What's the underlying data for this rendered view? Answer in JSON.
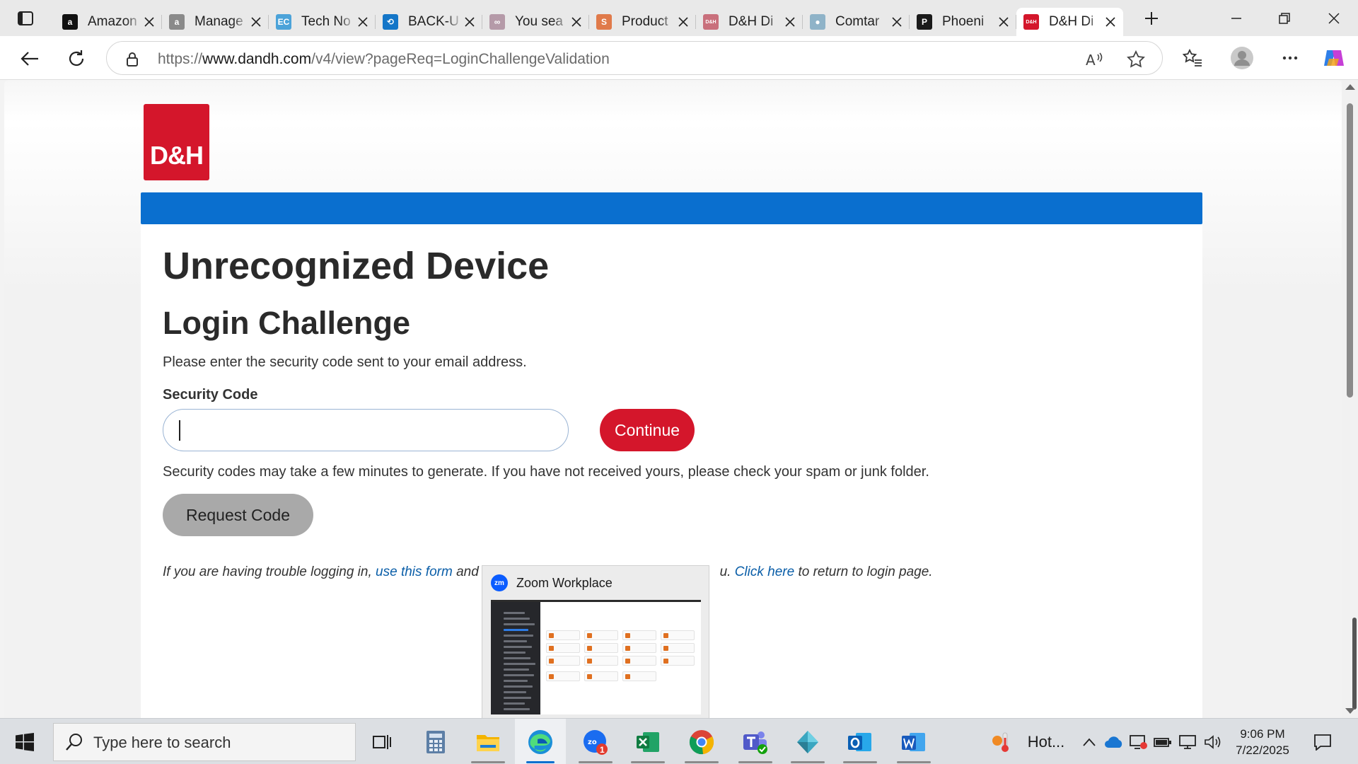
{
  "browser": {
    "tabs": [
      {
        "title": "Amazon",
        "favicon": "amazon-icon",
        "fav_color": "#111111",
        "fav_text": "a"
      },
      {
        "title": "Manage",
        "favicon": "amazon-grey-icon",
        "fav_color": "#8a8a8a",
        "fav_text": "a"
      },
      {
        "title": "Tech No",
        "favicon": "ec-icon",
        "fav_color": "#4ba3d9",
        "fav_text": "EC"
      },
      {
        "title": "BACK-U",
        "favicon": "backup-icon",
        "fav_color": "#1476c8",
        "fav_text": "⟲"
      },
      {
        "title": "You sea",
        "favicon": "people-icon",
        "fav_color": "#b59aa8",
        "fav_text": "∞"
      },
      {
        "title": "Product",
        "favicon": "product-icon",
        "fav_color": "#e07a4a",
        "fav_text": "S"
      },
      {
        "title": "D&H Di",
        "favicon": "dh-faded-icon",
        "fav_color": "#c9707c",
        "fav_text": "D&H"
      },
      {
        "title": "Comtar",
        "favicon": "comtar-icon",
        "fav_color": "#8fb3c8",
        "fav_text": "●"
      },
      {
        "title": "Phoeni",
        "favicon": "phoenix-icon",
        "fav_color": "#1a1a1a",
        "fav_text": "P"
      },
      {
        "title": "D&H Di",
        "favicon": "dh-icon",
        "fav_color": "#d4162b",
        "fav_text": "D&H",
        "active": true
      }
    ],
    "url_prefix": "https://",
    "url_host": "www.dandh.com",
    "url_path": "/v4/view?pageReq=LoginChallengeValidation"
  },
  "page": {
    "logo_text": "D&H",
    "title": "Unrecognized Device",
    "subtitle": "Login Challenge",
    "instructions": "Please enter the security code sent to your email address.",
    "field_label": "Security Code",
    "input_value": "",
    "continue_label": "Continue",
    "note": "Security codes may take a few minutes to generate. If you have not received yours, please check your spam or junk folder.",
    "request_label": "Request Code",
    "trouble_prefix": "If you are having trouble logging in, ",
    "trouble_link": "use this form",
    "trouble_middle_visible": " and c",
    "trouble_tail_visible": "u. ",
    "click_here_link": "Click here",
    "trouble_suffix": " to return to login page."
  },
  "popup": {
    "app_icon_text": "zm",
    "title": "Zoom Workplace"
  },
  "taskbar": {
    "search_placeholder": "Type here to search",
    "zoom_badge": "1",
    "weather_text": "Hot...",
    "time": "9:06 PM",
    "date": "7/22/2025"
  },
  "colors": {
    "brand_red": "#d4162b",
    "brand_blue": "#0a6fcf",
    "link": "#0a5ea8"
  }
}
